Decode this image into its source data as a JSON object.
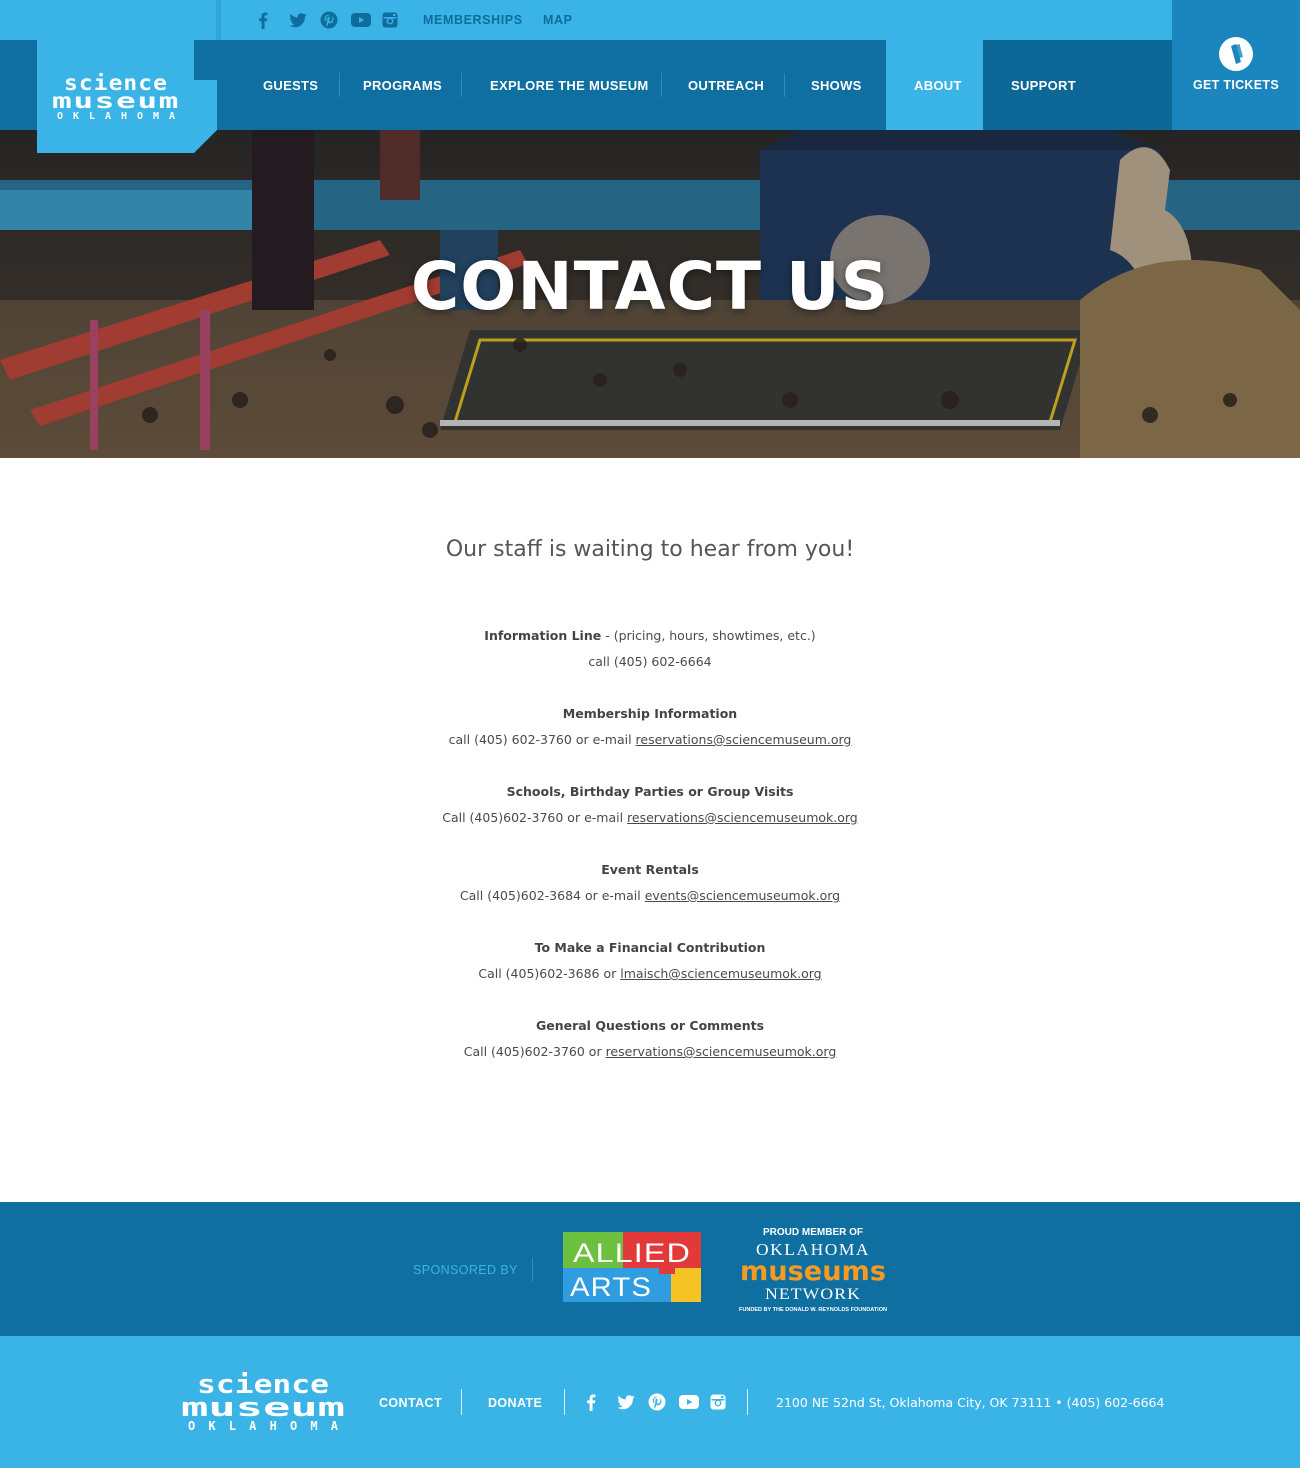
{
  "brand": {
    "logo_line1": "science",
    "logo_line2": "museum",
    "logo_line3": "OKLAHOMA",
    "colors": {
      "light_blue": "#3ab4e6",
      "dark_blue": "#0f6fa0",
      "mid_blue": "#1a86bd"
    }
  },
  "utility_nav": {
    "social_icons": [
      "facebook-icon",
      "twitter-icon",
      "pinterest-icon",
      "youtube-icon",
      "instagram-icon"
    ],
    "memberships": "MEMBERSHIPS",
    "map": "MAP"
  },
  "main_nav": {
    "items": [
      "GUESTS",
      "PROGRAMS",
      "EXPLORE THE MUSEUM",
      "OUTREACH",
      "SHOWS",
      "ABOUT",
      "SUPPORT"
    ],
    "active": "ABOUT",
    "tickets_icon": "ticket-icon",
    "tickets_label": "GET TICKETS"
  },
  "hero": {
    "title": "CONTACT US"
  },
  "content": {
    "tagline": "Our staff is waiting to hear from you!",
    "sections": [
      {
        "title": "Information Line",
        "title_suffix": " - (pricing, hours, showtimes, etc.)",
        "line": "call (405) 602-6664",
        "email": ""
      },
      {
        "title": "Membership Information",
        "title_suffix": "",
        "line": "call (405) 602-3760 or e-mail ",
        "email": "reservations@sciencemuseum.org"
      },
      {
        "title": "Schools, Birthday Parties or Group Visits",
        "title_suffix": "",
        "line": "Call (405)602-3760 or e-mail ",
        "email": "reservations@sciencemuseumok.org"
      },
      {
        "title": "Event Rentals",
        "title_suffix": "",
        "line": "Call (405)602-3684 or e-mail ",
        "email": "events@sciencemuseumok.org"
      },
      {
        "title": "To Make a Financial Contribution",
        "title_suffix": "",
        "line": "Call (405)602-3686 or ",
        "email": "lmaisch@sciencemuseumok.org"
      },
      {
        "title": "General Questions or Comments",
        "title_suffix": "",
        "line": "Call (405)602-3760 or ",
        "email": "reservations@sciencemuseumok.org"
      }
    ]
  },
  "sponsors": {
    "label": "SPONSORED BY",
    "allied_line1": "ALLIED",
    "allied_line2": "ARTS",
    "omn_header": "PROUD MEMBER OF",
    "omn_line1": "OKLAHOMA",
    "omn_line2": "museums",
    "omn_line3": "NETWORK",
    "omn_footer": "FUNDED BY THE DONALD W. REYNOLDS FOUNDATION"
  },
  "footer": {
    "contact": "CONTACT",
    "donate": "DONATE",
    "social_icons": [
      "facebook-icon",
      "twitter-icon",
      "pinterest-icon",
      "youtube-icon",
      "instagram-icon"
    ],
    "address": "2100 NE 52nd St, Oklahoma City, OK 73111  • (405) 602-6664"
  }
}
